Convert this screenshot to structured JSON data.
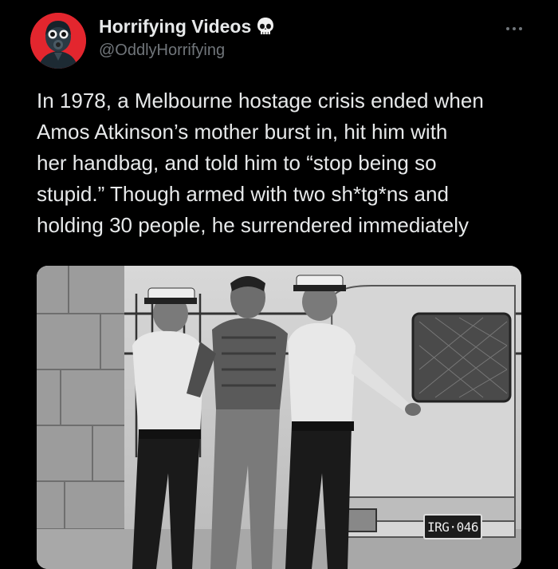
{
  "author": {
    "display_name": "Horrifying Videos",
    "handle": "@OddlyHorrifying",
    "badge_icon": "skull-icon",
    "avatar_bg": "#e3262e"
  },
  "menu": {
    "more_icon": "more-options-icon"
  },
  "tweet": {
    "text": "In 1978, a Melbourne hostage crisis ended when\nAmos Atkinson’s mother burst in, hit him with\nher handbag, and told him to “stop being so\nstupid.” Though armed with two sh*tg*ns and\nholding 30 people, he surrendered immediately"
  },
  "media": {
    "plate_text": "IRG·046"
  },
  "colors": {
    "background": "#000000",
    "text": "#e7e9ea",
    "secondary_text": "#71767b"
  }
}
